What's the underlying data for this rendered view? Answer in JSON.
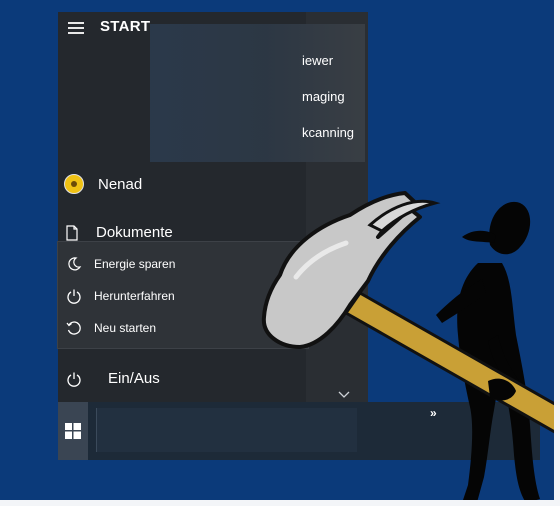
{
  "start_menu": {
    "title": "START",
    "apps": [
      {
        "label": "iewer"
      },
      {
        "label": "maging"
      },
      {
        "label": "kcanning"
      }
    ],
    "user": {
      "name": "Nenad",
      "icon": "avatar-sunflower-icon"
    },
    "documents": {
      "label": "Dokumente",
      "icon": "document-icon"
    },
    "power_menu": {
      "items": [
        {
          "label": "Energie sparen",
          "icon": "moon-icon"
        },
        {
          "label": "Herunterfahren",
          "icon": "power-icon"
        },
        {
          "label": "Neu starten",
          "icon": "restart-icon"
        }
      ]
    },
    "power_button": {
      "label": "Ein/Aus",
      "icon": "power-icon"
    }
  },
  "taskbar": {
    "overflow": "»",
    "start_icon": "windows-logo-icon"
  },
  "colors": {
    "desktop": "#0b3a7a",
    "menu_bg": "#24282d",
    "popup_bg": "#2f3338",
    "taskbar": "#1d2a38",
    "accent": "#f0c214"
  },
  "decoration": {
    "clipart": "stick-figure-with-hammer"
  }
}
